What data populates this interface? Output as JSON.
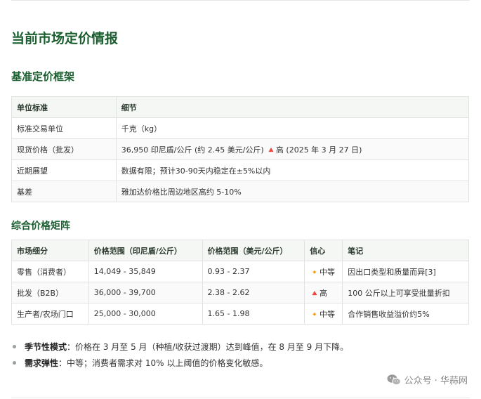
{
  "page_title": "当前市场定价情报",
  "section1": {
    "title": "基准定价框架",
    "headers": [
      "单位标准",
      "细节"
    ],
    "rows": [
      [
        "标准交易单位",
        "千克（kg）"
      ],
      [
        "现货价格（批发）",
        "36,950 印尼盾/公斤 (约 2.45 美元/公斤) 🔺高 (2025 年 3 月 27 日)"
      ],
      [
        "近期展望",
        "数据有限；预计30-90天内稳定在±5%以内"
      ],
      [
        "基差",
        "雅加达价格比周边地区高约 5-10%"
      ]
    ]
  },
  "section2": {
    "title": "综合价格矩阵",
    "headers": [
      "市场细分",
      "价格范围（印尼盾/公斤）",
      "价格范围（美元/公斤）",
      "信心",
      "笔记"
    ],
    "rows": [
      [
        "零售（消费者）",
        "14,049 - 35,849",
        "0.93 - 2.37",
        "🔸中等",
        "因出口类型和质量而异[3]"
      ],
      [
        "批发（B2B）",
        "36,000 - 39,700",
        "2.38 - 2.62",
        "🔺高",
        "100 公斤以上可享受批量折扣"
      ],
      [
        "生产者/农场门口",
        "25,000 - 30,000",
        "1.65 - 1.98",
        "🔸中等",
        "合作销售收益溢价约5%"
      ]
    ]
  },
  "bullets": [
    {
      "label": "季节性模式",
      "sep": "：",
      "text": "价格在 3 月至 5 月（种植/收获过渡期）达到峰值，在 8 月至 9 月下降。"
    },
    {
      "label": "需求弹性",
      "sep": "：",
      "text": "中等；消费者需求对 10% 以上阈值的价格变化敏感。"
    }
  ],
  "watermark": {
    "text": "公众号 · 华蒜网",
    "icon": "wechat-icon"
  }
}
